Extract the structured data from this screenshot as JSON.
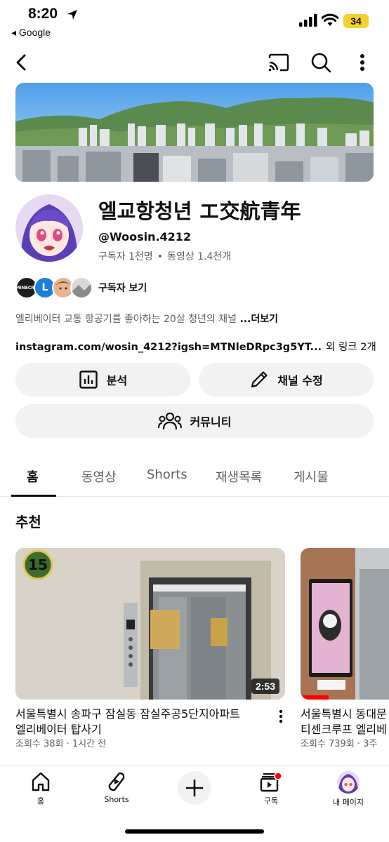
{
  "status_bar": {
    "time": "8:20",
    "back_app": "◂ Google",
    "battery": "34"
  },
  "channel": {
    "name": "엘교항청년 エ交航青年",
    "handle": "@Woosin.4212",
    "subscribers": "구독자 1천명",
    "video_count": "동영상 1.4천개",
    "meta_separator": "•",
    "view_subscribers": "구독자 보기",
    "description": "엘리베이터 교통 항공기를 좋아하는 20살 청년의 채널",
    "more_label": "...더보기",
    "link": "instagram.com/wosin_4212?igsh=MTNleDRpc3g5YT...",
    "other_links": "외 링크 2개",
    "subscriber_avatar_letter": "L",
    "subscriber_avatar_text": "MINECRA"
  },
  "buttons": {
    "analytics": "분석",
    "edit_channel": "채널 수정",
    "community": "커뮤니티"
  },
  "tabs": [
    "홈",
    "동영상",
    "Shorts",
    "재생목록",
    "게시물"
  ],
  "section_title": "추천",
  "videos": [
    {
      "title_line1": "서울특별시 송파구 잠실동 잠실주공5단지아파트",
      "title_line2": "엘리베이터 탑사기",
      "meta": "조회수 38회 · 1시간 전",
      "duration": "2:53",
      "floor_sign": "15"
    },
    {
      "title_line1": "서울특별시 동대문",
      "title_line2": "티센크루프 엘리베",
      "meta": "조회수 739회 · 3주"
    }
  ],
  "bottom_nav": {
    "home": "홈",
    "shorts": "Shorts",
    "subscriptions": "구독",
    "you": "내 페이지"
  },
  "colors": {
    "accent_red": "#ff0000",
    "battery_yellow": "#f7d02d",
    "chip_bg": "#f2f2f2"
  }
}
